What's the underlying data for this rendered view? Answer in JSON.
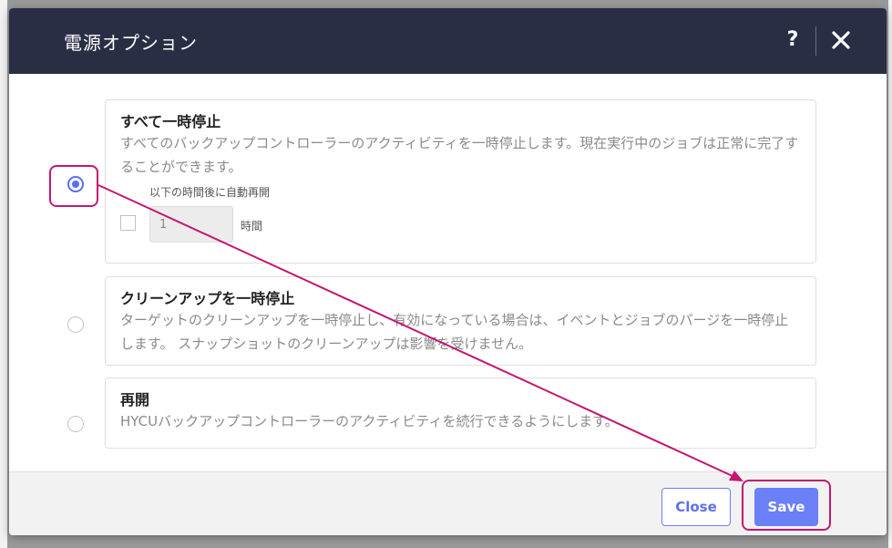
{
  "dialog": {
    "title": "電源オプション",
    "help_symbol": "?"
  },
  "options": [
    {
      "title": "すべて一時停止",
      "description": "すべてのバックアップコントローラーのアクティビティを一時停止します。現在実行中のジョブは正常に完了することができます。",
      "selected": true,
      "auto_resume": {
        "label": "以下の時間後に自動再開",
        "value": "1",
        "unit": "時間",
        "checked": false
      }
    },
    {
      "title": "クリーンアップを一時停止",
      "description": "ターゲットのクリーンアップを一時停止し、有効になっている場合は、イベントとジョブのパージを一時停止します。 スナップショットのクリーンアップは影響を受けません。",
      "selected": false
    },
    {
      "title": "再開",
      "description": "HYCUバックアップコントローラーのアクティビティを続行できるようにします。",
      "selected": false
    }
  ],
  "footer": {
    "close_label": "Close",
    "save_label": "Save"
  },
  "colors": {
    "header_bg": "#2a2e45",
    "accent": "#6b7ff7",
    "annotation": "#c4176f"
  }
}
